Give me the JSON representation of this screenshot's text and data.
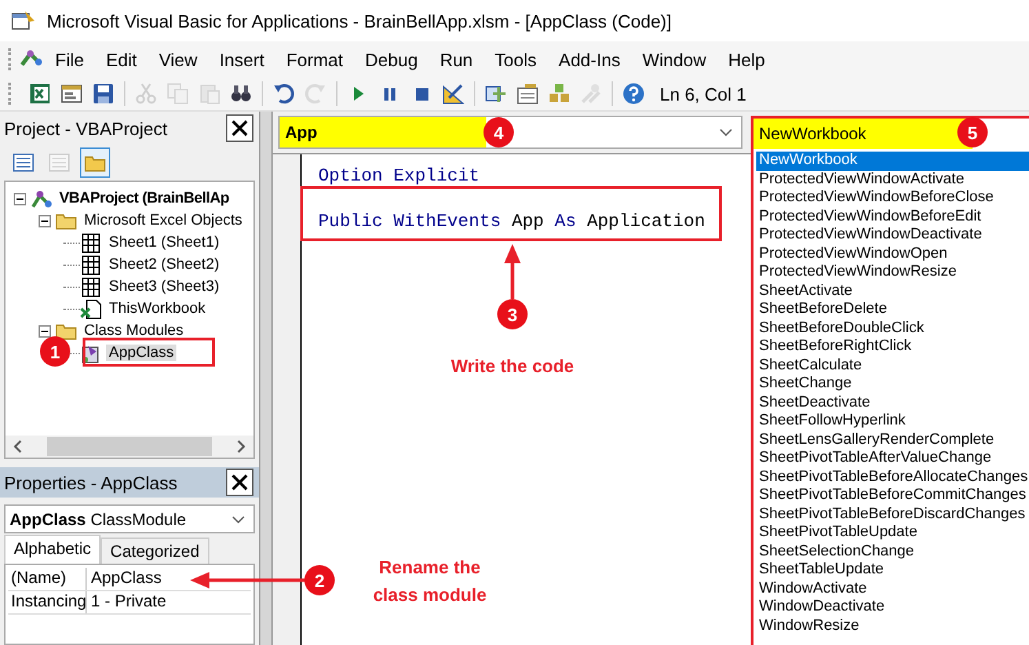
{
  "window": {
    "title": "Microsoft Visual Basic for Applications - BrainBellApp.xlsm - [AppClass (Code)]"
  },
  "menu": [
    "File",
    "Edit",
    "View",
    "Insert",
    "Format",
    "Debug",
    "Run",
    "Tools",
    "Add-Ins",
    "Window",
    "Help"
  ],
  "toolbar": [
    {
      "kind": "excel",
      "disabled": false
    },
    {
      "kind": "insert-form",
      "disabled": false
    },
    {
      "kind": "save",
      "disabled": false
    },
    {
      "kind": "sep"
    },
    {
      "kind": "cut",
      "disabled": true
    },
    {
      "kind": "copy",
      "disabled": true
    },
    {
      "kind": "paste",
      "disabled": true
    },
    {
      "kind": "find",
      "disabled": false
    },
    {
      "kind": "sep"
    },
    {
      "kind": "undo",
      "disabled": false
    },
    {
      "kind": "redo",
      "disabled": true
    },
    {
      "kind": "sep"
    },
    {
      "kind": "run",
      "disabled": false
    },
    {
      "kind": "pause",
      "disabled": false
    },
    {
      "kind": "stop",
      "disabled": false
    },
    {
      "kind": "design",
      "disabled": false
    },
    {
      "kind": "sep"
    },
    {
      "kind": "project",
      "disabled": false
    },
    {
      "kind": "properties",
      "disabled": false
    },
    {
      "kind": "object-browser",
      "disabled": false
    },
    {
      "kind": "toolbox",
      "disabled": true
    },
    {
      "kind": "sep"
    },
    {
      "kind": "help",
      "disabled": false
    }
  ],
  "status": "Ln 6, Col 1",
  "project": {
    "title": "Project - VBAProject",
    "toolbar": [
      {
        "kind": "view-code",
        "disabled": false,
        "pressed": false
      },
      {
        "kind": "view-object",
        "disabled": true,
        "pressed": false
      },
      {
        "kind": "toggle-folders",
        "disabled": false,
        "pressed": true
      }
    ],
    "tree": [
      {
        "label": "VBAProject (BrainBellAp",
        "kind": "project",
        "bold": true,
        "selected": false,
        "expanded": true,
        "children": [
          {
            "label": "Microsoft Excel Objects",
            "kind": "folder",
            "bold": false,
            "selected": false,
            "expanded": true,
            "children": [
              {
                "label": "Sheet1 (Sheet1)",
                "kind": "sheet",
                "bold": false,
                "selected": false
              },
              {
                "label": "Sheet2 (Sheet2)",
                "kind": "sheet",
                "bold": false,
                "selected": false
              },
              {
                "label": "Sheet3 (Sheet3)",
                "kind": "sheet",
                "bold": false,
                "selected": false
              },
              {
                "label": "ThisWorkbook",
                "kind": "workbook",
                "bold": false,
                "selected": false
              }
            ]
          },
          {
            "label": "Class Modules",
            "kind": "folder",
            "bold": false,
            "selected": false,
            "expanded": true,
            "children": [
              {
                "label": "AppClass",
                "kind": "class",
                "bold": false,
                "selected": true
              }
            ]
          }
        ]
      }
    ]
  },
  "properties": {
    "title": "Properties - AppClass",
    "object_name": "AppClass",
    "object_type": "ClassModule",
    "tabs": [
      {
        "label": "Alphabetic",
        "selected": true
      },
      {
        "label": "Categorized",
        "selected": false
      }
    ],
    "rows": [
      {
        "name": "(Name)",
        "value": "AppClass"
      },
      {
        "name": "Instancing",
        "value": "1 - Private"
      }
    ]
  },
  "code_window": {
    "object_combo": {
      "value": "App",
      "highlighted": true
    },
    "procedure_combo": {
      "value": "NewWorkbook",
      "highlighted": true
    },
    "lines": [
      [
        {
          "text": "Option Explicit",
          "kind": "keyword"
        }
      ],
      [
        {
          "text": "Public WithEvents ",
          "kind": "keyword"
        },
        {
          "text": "App ",
          "kind": "plain"
        },
        {
          "text": "As ",
          "kind": "keyword"
        },
        {
          "text": "Application",
          "kind": "plain"
        }
      ]
    ],
    "procedure_list": [
      {
        "label": "NewWorkbook",
        "selected": true
      },
      {
        "label": "ProtectedViewWindowActivate",
        "selected": false
      },
      {
        "label": "ProtectedViewWindowBeforeClose",
        "selected": false
      },
      {
        "label": "ProtectedViewWindowBeforeEdit",
        "selected": false
      },
      {
        "label": "ProtectedViewWindowDeactivate",
        "selected": false
      },
      {
        "label": "ProtectedViewWindowOpen",
        "selected": false
      },
      {
        "label": "ProtectedViewWindowResize",
        "selected": false
      },
      {
        "label": "SheetActivate",
        "selected": false
      },
      {
        "label": "SheetBeforeDelete",
        "selected": false
      },
      {
        "label": "SheetBeforeDoubleClick",
        "selected": false
      },
      {
        "label": "SheetBeforeRightClick",
        "selected": false
      },
      {
        "label": "SheetCalculate",
        "selected": false
      },
      {
        "label": "SheetChange",
        "selected": false
      },
      {
        "label": "SheetDeactivate",
        "selected": false
      },
      {
        "label": "SheetFollowHyperlink",
        "selected": false
      },
      {
        "label": "SheetLensGalleryRenderComplete",
        "selected": false
      },
      {
        "label": "SheetPivotTableAfterValueChange",
        "selected": false
      },
      {
        "label": "SheetPivotTableBeforeAllocateChanges",
        "selected": false
      },
      {
        "label": "SheetPivotTableBeforeCommitChanges",
        "selected": false
      },
      {
        "label": "SheetPivotTableBeforeDiscardChanges",
        "selected": false
      },
      {
        "label": "SheetPivotTableUpdate",
        "selected": false
      },
      {
        "label": "SheetSelectionChange",
        "selected": false
      },
      {
        "label": "SheetTableUpdate",
        "selected": false
      },
      {
        "label": "WindowActivate",
        "selected": false
      },
      {
        "label": "WindowDeactivate",
        "selected": false
      },
      {
        "label": "WindowResize",
        "selected": false
      }
    ]
  },
  "callouts": [
    {
      "number": "1"
    },
    {
      "number": "2",
      "text": "Rename the class module"
    },
    {
      "number": "3",
      "text": "Write the code"
    },
    {
      "number": "4"
    },
    {
      "number": "5"
    }
  ]
}
